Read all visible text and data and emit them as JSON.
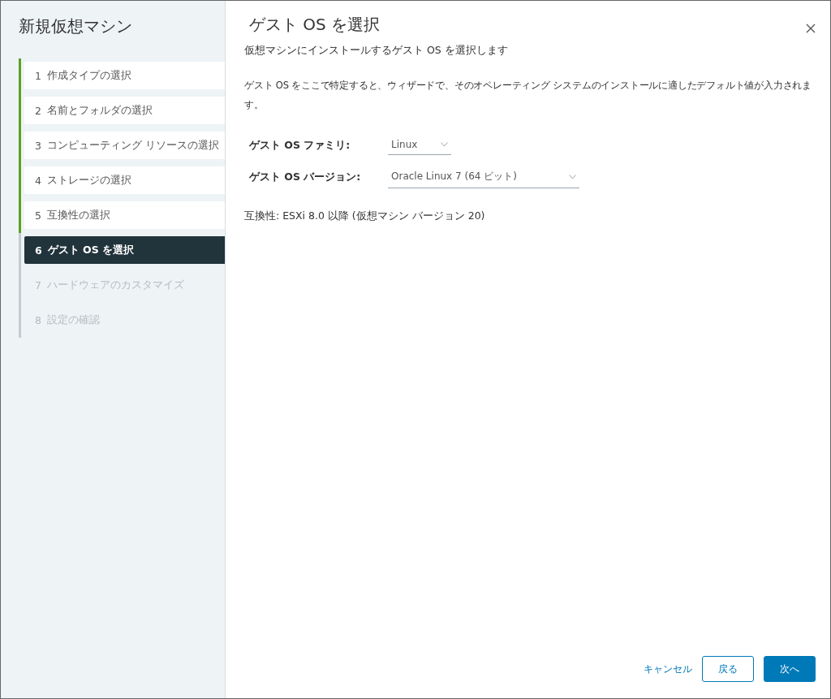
{
  "wizard": {
    "title": "新規仮想マシン"
  },
  "steps": [
    {
      "number": "1",
      "label": "作成タイプの選択",
      "completed": true,
      "selected": false
    },
    {
      "number": "2",
      "label": "名前とフォルダの選択",
      "completed": true,
      "selected": false
    },
    {
      "number": "3",
      "label": "コンピューティング リソースの選択",
      "completed": true,
      "selected": false
    },
    {
      "number": "4",
      "label": "ストレージの選択",
      "completed": true,
      "selected": false
    },
    {
      "number": "5",
      "label": "互換性の選択",
      "completed": true,
      "selected": false
    },
    {
      "number": "6",
      "label": "ゲスト OS を選択",
      "completed": false,
      "selected": true
    },
    {
      "number": "7",
      "label": "ハードウェアのカスタマイズ",
      "completed": false,
      "selected": false
    },
    {
      "number": "8",
      "label": "設定の確認",
      "completed": false,
      "selected": false
    }
  ],
  "page": {
    "title": "ゲスト OS を選択",
    "subtitle": "仮想マシンにインストールするゲスト OS を選択します",
    "description": "ゲスト OS をここで特定すると、ウィザードで、そのオペレーティング システムのインストールに適したデフォルト値が入力されます。"
  },
  "fields": [
    {
      "label": "ゲスト OS ファミリ:",
      "value": "Linux"
    },
    {
      "label": "ゲスト OS バージョン:",
      "value": "Oracle Linux 7 (64 ビット)"
    }
  ],
  "compatibility": "互換性: ESXi 8.0 以降 (仮想マシン バージョン 20)",
  "footer": {
    "cancel": "キャンセル",
    "back": "戻る",
    "next": "次へ"
  }
}
